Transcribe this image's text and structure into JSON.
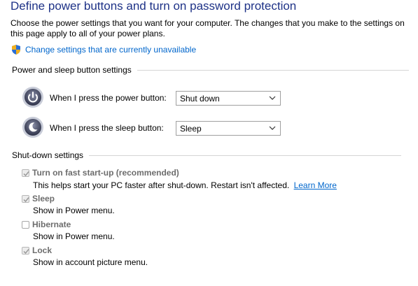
{
  "header": {
    "title": "Define power buttons and turn on password protection",
    "intro": "Choose the power settings that you want for your computer. The changes that you make to the settings on this page apply to all of your power plans.",
    "change_link": "Change settings that are currently unavailable",
    "change_icon": "uac-shield-icon"
  },
  "button_section": {
    "heading": "Power and sleep button settings",
    "rows": [
      {
        "label": "When I press the power button:",
        "value": "Shut down",
        "icon": "power-button-icon"
      },
      {
        "label": "When I press the sleep button:",
        "value": "Sleep",
        "icon": "sleep-button-icon"
      }
    ]
  },
  "shutdown_section": {
    "heading": "Shut-down settings",
    "options": [
      {
        "label": "Turn on fast start-up (recommended)",
        "checked": true,
        "desc": "This helps start your PC faster after shut-down. Restart isn't affected.",
        "link": "Learn More"
      },
      {
        "label": "Sleep",
        "checked": true,
        "desc": "Show in Power menu."
      },
      {
        "label": "Hibernate",
        "checked": false,
        "desc": "Show in Power menu."
      },
      {
        "label": "Lock",
        "checked": true,
        "desc": "Show in account picture menu."
      }
    ]
  },
  "colors": {
    "title": "#1e3287",
    "link": "#0066cc",
    "disabled_text": "#6d6d6d"
  }
}
